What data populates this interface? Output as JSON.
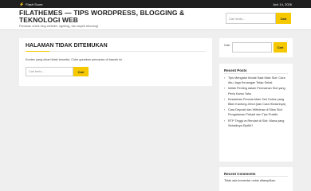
{
  "topbar": {
    "flash_label": "Flash Score",
    "date": "Juni 14, 2026"
  },
  "header": {
    "site_title": "FILATHEMES — TIPS WORDPRESS, BLOGGING & TEKNOLOGI WEB",
    "site_description": "Panduan untuk blog website, ngeblog, dan aspek teknologi",
    "search_placeholder": "Cari tentu...",
    "search_button": "Cari"
  },
  "main": {
    "heading": "HALAMAN TIDAK DITEMUKAN",
    "message": "Konten yang dicari tidak tersedia. Coba gunakan pencarian di bawah ini.",
    "search_placeholder": "Cari tentu...",
    "search_button": "Cari"
  },
  "sidebar": {
    "search_label": "Cari",
    "search_button": "Cari",
    "recent_title": "Recent Posts",
    "recent_posts": [
      "Tips Mengatur Modal Saat Main Slot: Cara Aku Jaga Keuangan Tetap Sehat",
      "Istilah Penting dalam Permainan Slot yang Perlu Kamu Tahu",
      "Kesalahan Pemula Main Slot Online yang Bikin Kantong Jebol (dan Cara Hindarinya)",
      "Cara Deposit dan Withdraw di Situs Slot: Pengalaman Pribadi dan Tips Praktis",
      "RTP Tinggi vs Rendah di Slot: Mana yang Sebaiknya Dipilih?"
    ],
    "comments_title": "Recent Comments",
    "comments_empty": "Tidak ada komentar untuk ditampilkan."
  }
}
